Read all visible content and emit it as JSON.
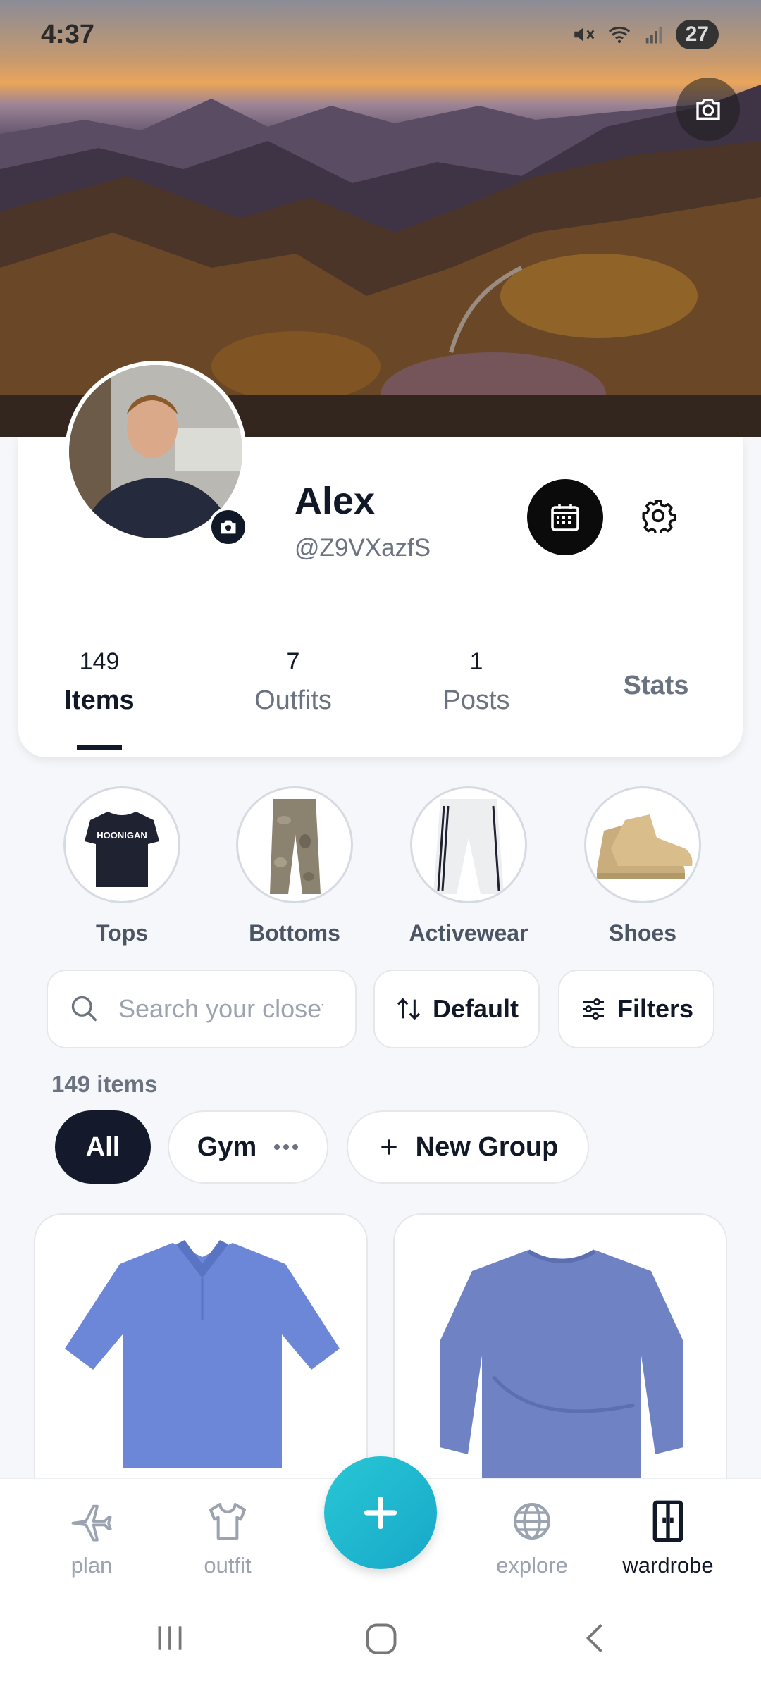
{
  "status_bar": {
    "time": "4:37",
    "battery": "27"
  },
  "profile": {
    "name": "Alex",
    "handle": "@Z9VXazfS"
  },
  "tabs": [
    {
      "count": "149",
      "label": "Items"
    },
    {
      "count": "7",
      "label": "Outfits"
    },
    {
      "count": "1",
      "label": "Posts"
    },
    {
      "label": "Stats"
    }
  ],
  "categories": [
    {
      "label": "Tops",
      "icon": "tshirt-image"
    },
    {
      "label": "Bottoms",
      "icon": "camo-pants-image"
    },
    {
      "label": "Activewear",
      "icon": "track-pants-image"
    },
    {
      "label": "Shoes",
      "icon": "sneakers-image"
    }
  ],
  "search": {
    "placeholder": "Search your closet"
  },
  "sort": {
    "label": "Default"
  },
  "filters": {
    "label": "Filters"
  },
  "item_count": "149 items",
  "groups": [
    {
      "label": "All"
    },
    {
      "label": "Gym"
    },
    {
      "label": "New Group"
    }
  ],
  "tops_shirt_text": "HOONIGAN",
  "bottom_nav": [
    {
      "label": "plan",
      "icon": "airplane-icon"
    },
    {
      "label": "outfit",
      "icon": "shirt-icon"
    },
    {
      "label": "explore",
      "icon": "globe-icon"
    },
    {
      "label": "wardrobe",
      "icon": "wardrobe-icon"
    }
  ],
  "colors": {
    "accent": "#1fb8cf",
    "dark": "#111827",
    "muted": "#6b7280"
  }
}
